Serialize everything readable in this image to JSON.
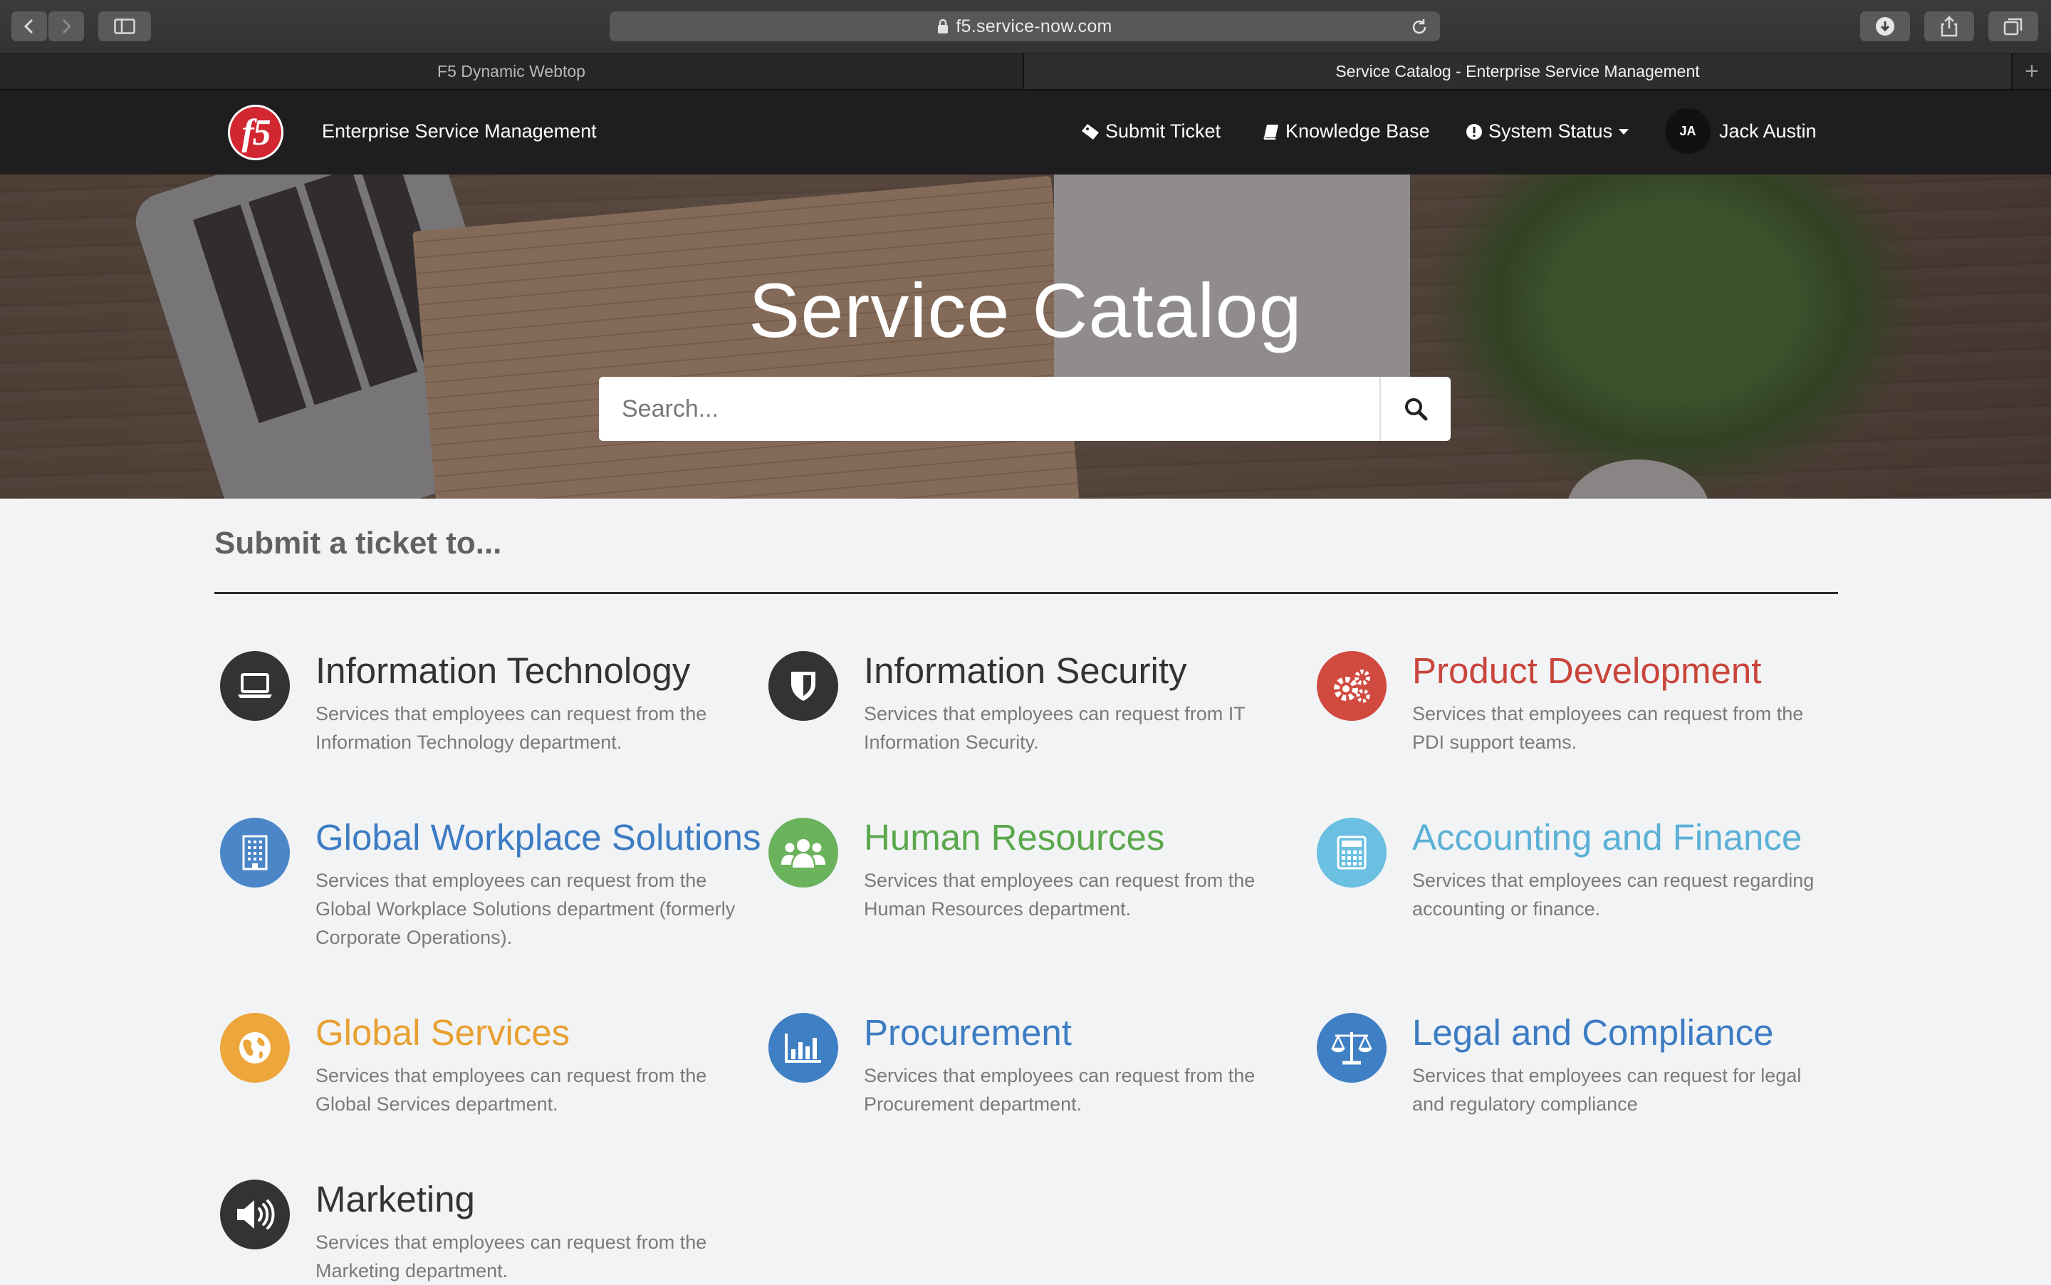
{
  "browser": {
    "url": "f5.service-now.com",
    "tabs": [
      {
        "label": "F5 Dynamic Webtop",
        "active": false
      },
      {
        "label": "Service Catalog - Enterprise Service Management",
        "active": true
      }
    ]
  },
  "nav": {
    "brand": "Enterprise Service Management",
    "logo_text": "f5",
    "submit_ticket": "Submit Ticket",
    "knowledge_base": "Knowledge Base",
    "system_status": "System Status",
    "user_initials": "JA",
    "user_name": "Jack Austin"
  },
  "hero": {
    "title": "Service Catalog",
    "search_placeholder": "Search..."
  },
  "main": {
    "section_title": "Submit a ticket to...",
    "categories": [
      {
        "title": "Information Technology",
        "desc": "Services that employees can request from the Information Technology department.",
        "color": "#333333",
        "icon_bg": "#333333",
        "icon": "laptop-icon"
      },
      {
        "title": "Information Security",
        "desc": "Services that employees can request from IT Information Security.",
        "color": "#333333",
        "icon_bg": "#333333",
        "icon": "shield-icon"
      },
      {
        "title": "Product Development",
        "desc": "Services that employees can request from the PDI support teams.",
        "color": "#c9453b",
        "icon_bg": "#d04a40",
        "icon": "gears-icon"
      },
      {
        "title": "Global Workplace Solutions",
        "desc": "Services that employees can request from the Global Workplace Solutions department (formerly Corporate Operations).",
        "color": "#3d7cc3",
        "icon_bg": "#4a86c8",
        "icon": "building-icon"
      },
      {
        "title": "Human Resources",
        "desc": "Services that employees can request from the Human Resources department.",
        "color": "#5aa84b",
        "icon_bg": "#6ab35c",
        "icon": "users-icon"
      },
      {
        "title": "Accounting and Finance",
        "desc": "Services that employees can request regarding accounting or finance.",
        "color": "#5bb0d6",
        "icon_bg": "#6bbfe0",
        "icon": "calculator-icon"
      },
      {
        "title": "Global Services",
        "desc": "Services that employees can request from the Global Services department.",
        "color": "#e8a030",
        "icon_bg": "#eca63c",
        "icon": "globe-icon"
      },
      {
        "title": "Procurement",
        "desc": "Services that employees can request from the Procurement department.",
        "color": "#3d7cc3",
        "icon_bg": "#3f7fc3",
        "icon": "bar-chart-icon"
      },
      {
        "title": "Legal and Compliance",
        "desc": "Services that employees can request for legal and regulatory compliance",
        "color": "#3d7cc3",
        "icon_bg": "#3f7fc3",
        "icon": "scales-icon"
      },
      {
        "title": "Marketing",
        "desc": "Services that employees can request from the Marketing department.",
        "color": "#333333",
        "icon_bg": "#333333",
        "icon": "megaphone-icon"
      }
    ]
  }
}
